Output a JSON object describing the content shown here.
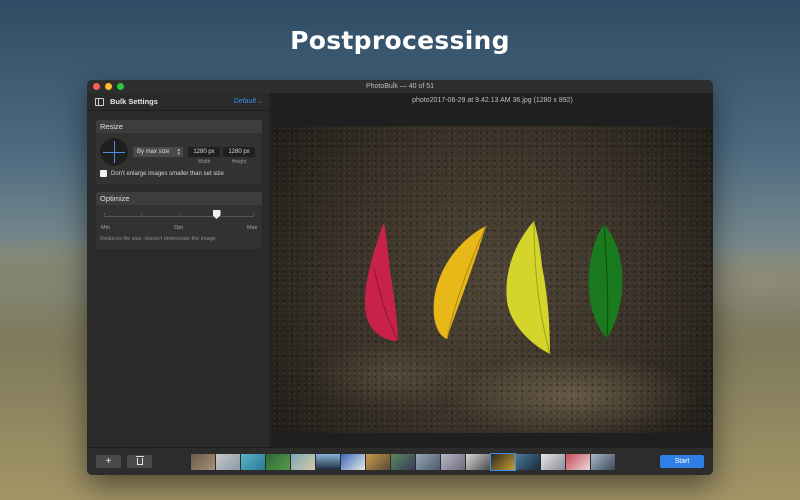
{
  "promo": {
    "headline": "Postprocessing"
  },
  "window": {
    "title": "PhotoBulk — 40 of 51"
  },
  "sidebar": {
    "title": "Bulk Settings",
    "preset": "Default",
    "resize": {
      "header": "Resize",
      "mode": "By max size",
      "width_value": "1280 px",
      "width_label": "Width",
      "height_value": "1280 px",
      "height_label": "Height",
      "checkbox_label": "Don't enlarge images smaller than set size",
      "checkbox_checked": false
    },
    "optimize": {
      "header": "Optimize",
      "min_label": "Min",
      "opt_label": "Opt",
      "max_label": "Max",
      "level": 0.75,
      "note": "Reduces file size, doesn't deteriorate the image"
    }
  },
  "main": {
    "file_title": "photo2017-06-29 at 9.42.13 AM 36.jpg (1280 x 892)"
  },
  "footer": {
    "add_label": "+",
    "start_label": "Start",
    "selected_thumb": 12
  },
  "colors": {
    "accent": "#3b8ff0",
    "leaves": [
      "#c8224a",
      "#e8b818",
      "#d4d42a",
      "#1a7a1e"
    ]
  }
}
